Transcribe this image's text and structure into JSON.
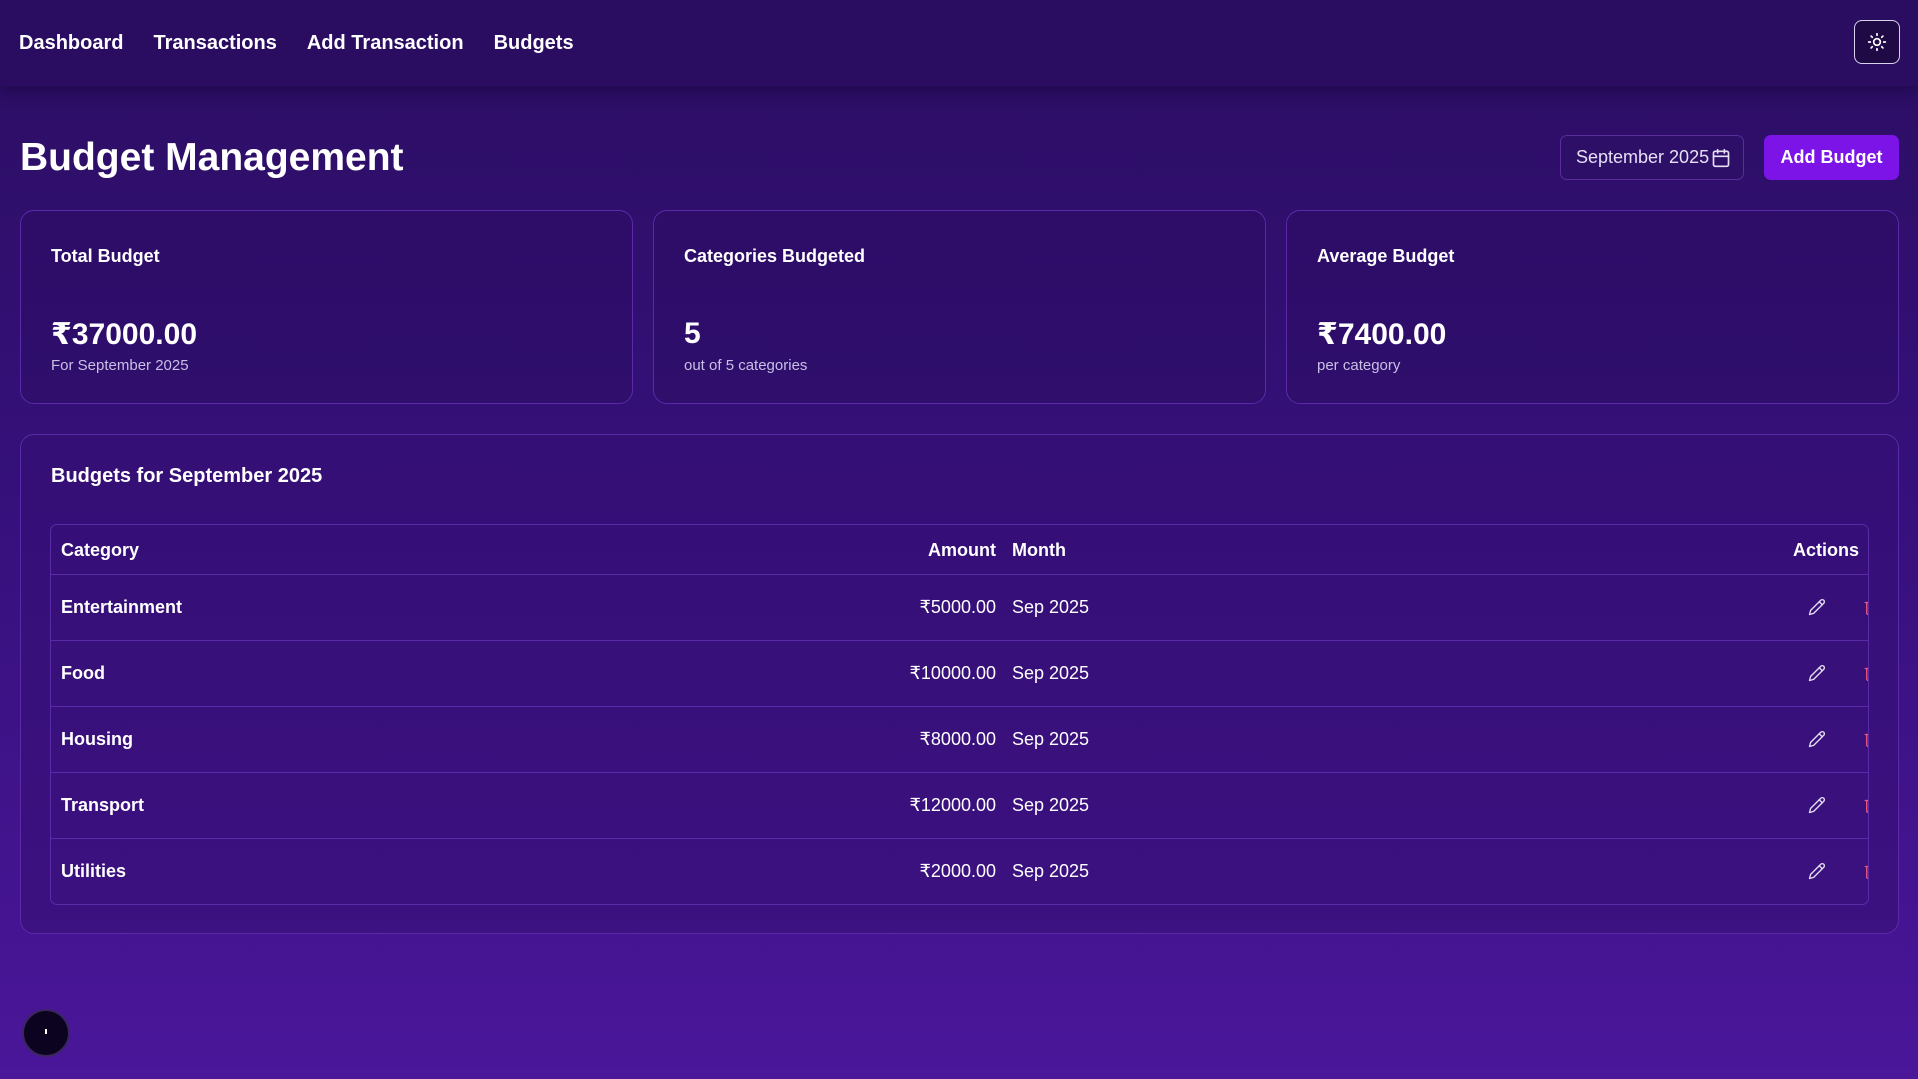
{
  "nav": {
    "links": [
      "Dashboard",
      "Transactions",
      "Add Transaction",
      "Budgets"
    ],
    "theme_toggle_icon": "sun-icon"
  },
  "header": {
    "title": "Budget Management",
    "month_value": "September 2025",
    "add_budget_label": "Add Budget"
  },
  "stats": [
    {
      "label": "Total Budget",
      "value": "₹37000.00",
      "sub": "For September 2025"
    },
    {
      "label": "Categories Budgeted",
      "value": "5",
      "sub": "out of 5 categories"
    },
    {
      "label": "Average Budget",
      "value": "₹7400.00",
      "sub": "per category"
    }
  ],
  "table": {
    "title": "Budgets for September 2025",
    "columns": [
      "Category",
      "Amount",
      "Month",
      "Actions"
    ],
    "rows": [
      {
        "category": "Entertainment",
        "amount": "₹5000.00",
        "month": "Sep 2025"
      },
      {
        "category": "Food",
        "amount": "₹10000.00",
        "month": "Sep 2025"
      },
      {
        "category": "Housing",
        "amount": "₹8000.00",
        "month": "Sep 2025"
      },
      {
        "category": "Transport",
        "amount": "₹12000.00",
        "month": "Sep 2025"
      },
      {
        "category": "Utilities",
        "amount": "₹2000.00",
        "month": "Sep 2025"
      }
    ]
  },
  "colors": {
    "accent": "#7c14e8",
    "delete": "#f05a7a",
    "background_top": "#2b0e62",
    "background_bottom": "#4a169a"
  }
}
